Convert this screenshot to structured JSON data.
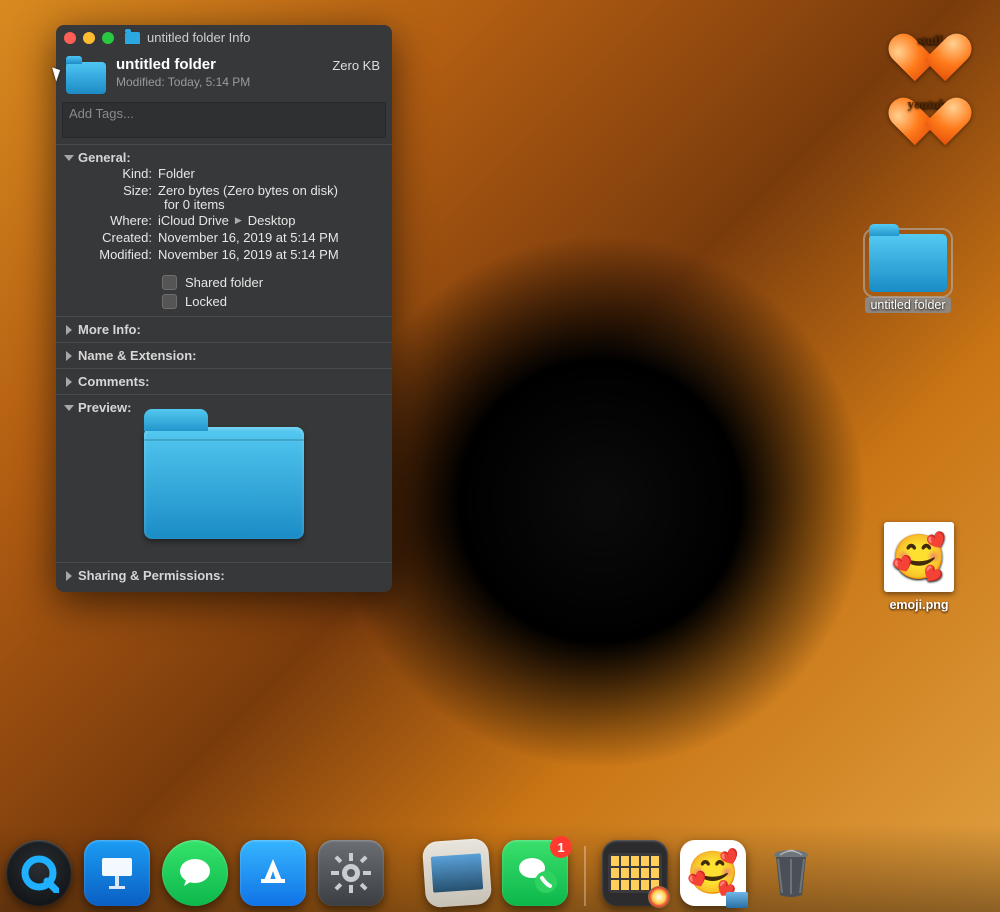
{
  "window": {
    "title": "untitled folder Info",
    "header": {
      "name": "untitled folder",
      "modified_line": "Modified: Today, 5:14 PM",
      "size": "Zero KB"
    },
    "tags_placeholder": "Add Tags...",
    "general": {
      "title": "General:",
      "kind_label": "Kind:",
      "kind_value": "Folder",
      "size_label": "Size:",
      "size_value": "Zero bytes (Zero bytes on disk)",
      "size_sub": "for 0 items",
      "where_label": "Where:",
      "where_1": "iCloud Drive",
      "where_2": "Desktop",
      "created_label": "Created:",
      "created_value": "November 16, 2019 at 5:14 PM",
      "modified_label": "Modified:",
      "modified_value": "November 16, 2019 at 5:14 PM",
      "shared_label": "Shared folder",
      "locked_label": "Locked"
    },
    "sections": {
      "more_info": "More Info:",
      "name_ext": "Name & Extension:",
      "comments": "Comments:",
      "preview": "Preview:",
      "sharing": "Sharing & Permissions:"
    }
  },
  "desktop": {
    "heart1": "stuff",
    "heart2": "youtube",
    "untitled_folder": "untitled folder",
    "emoji_file": "emoji.png"
  },
  "dock": {
    "messages_badge": "1",
    "apps": {
      "quicktime": "QuickTime",
      "keynote": "Keynote",
      "messages": "Messages",
      "appstore": "App Store",
      "settings": "System Preferences",
      "photos": "Photos",
      "facetime_msgs": "Messages-FaceTime",
      "finder_window": "Finder Window",
      "preview_emoji": "Preview",
      "trash": "Trash"
    }
  }
}
